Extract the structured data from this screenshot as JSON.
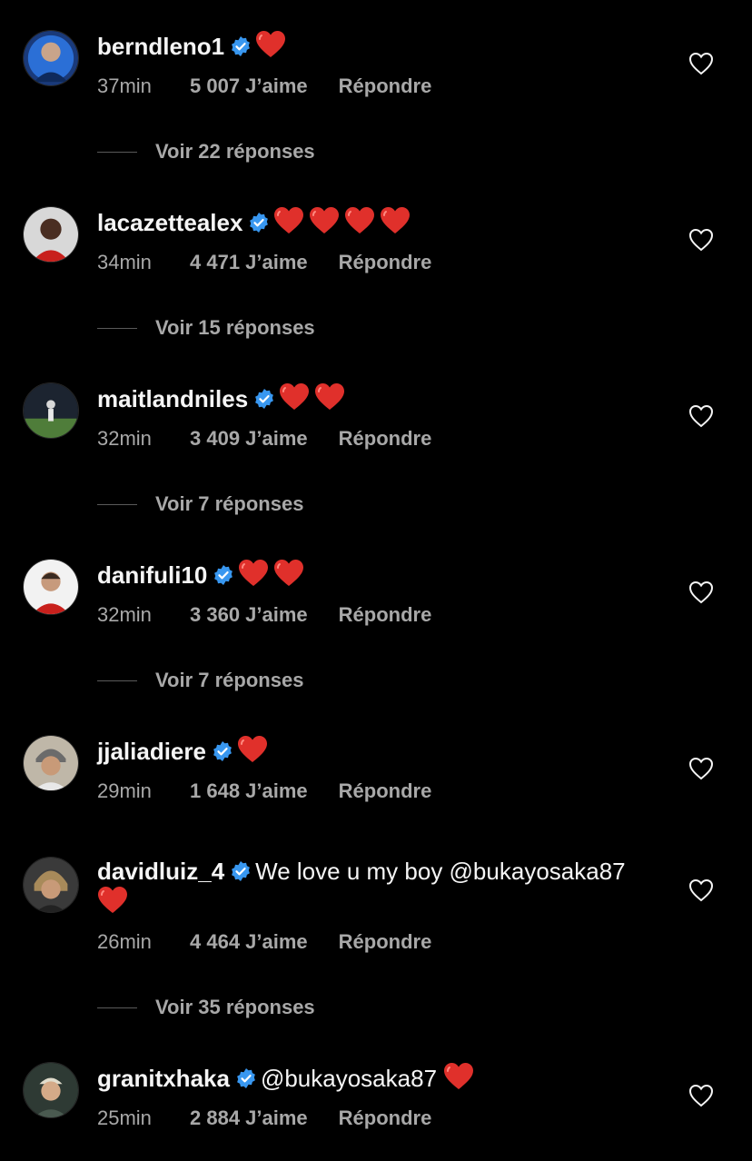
{
  "colors": {
    "background": "#000000",
    "text": "#f5f5f5",
    "secondary": "#a8a8a8",
    "verified": "#3897f0",
    "heart_emoji": "#e0302b"
  },
  "icons": {
    "verified": "verified-badge-icon",
    "heart_emoji": "red-heart-emoji",
    "like": "heart-outline-icon"
  },
  "comments": [
    {
      "username": "berndleno1",
      "text": "",
      "hearts": 1,
      "time": "37min",
      "likes": "5 007 J’aime",
      "reply": "Répondre",
      "replies": "Voir 22 réponses"
    },
    {
      "username": "lacazettealex",
      "text": "",
      "hearts": 4,
      "time": "34min",
      "likes": "4 471 J’aime",
      "reply": "Répondre",
      "replies": "Voir 15 réponses"
    },
    {
      "username": "maitlandniles",
      "text": "",
      "hearts": 2,
      "time": "32min",
      "likes": "3 409 J’aime",
      "reply": "Répondre",
      "replies": "Voir 7 réponses"
    },
    {
      "username": "danifuli10",
      "text": "",
      "hearts": 2,
      "time": "32min",
      "likes": "3 360 J’aime",
      "reply": "Répondre",
      "replies": "Voir 7 réponses"
    },
    {
      "username": "jjaliadiere",
      "text": "",
      "hearts": 1,
      "time": "29min",
      "likes": "1 648 J’aime",
      "reply": "Répondre",
      "replies": ""
    },
    {
      "username": "davidluiz_4",
      "text": "We love u my boy @bukayosaka87",
      "hearts": 1,
      "time": "26min",
      "likes": "4 464 J’aime",
      "reply": "Répondre",
      "replies": "Voir 35 réponses"
    },
    {
      "username": "granitxhaka",
      "text": "@bukayosaka87",
      "hearts": 1,
      "time": "25min",
      "likes": "2 884 J’aime",
      "reply": "Répondre",
      "replies": ""
    }
  ]
}
